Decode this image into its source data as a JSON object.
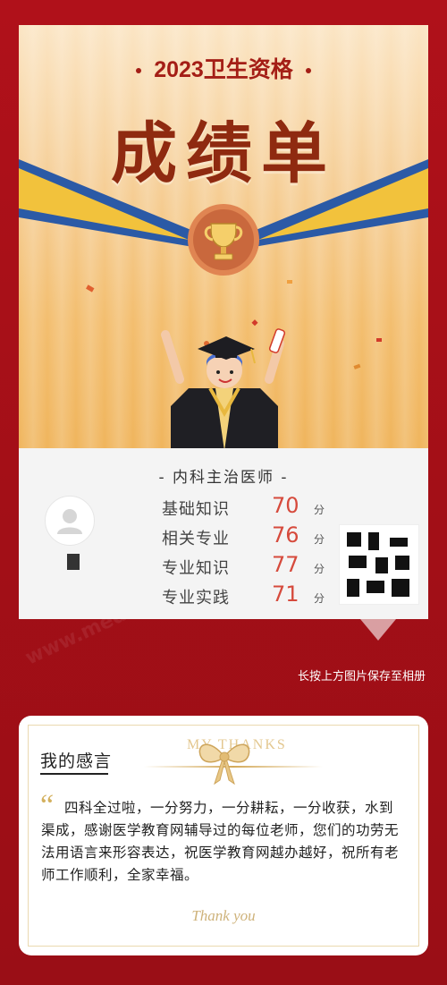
{
  "certificate": {
    "year_title": "2023卫生资格",
    "main_title": "成绩单",
    "subject": "- 内科主治医师 -",
    "scores": [
      {
        "name": "基础知识",
        "score": "70",
        "unit": "分"
      },
      {
        "name": "相关专业",
        "score": "76",
        "unit": "分"
      },
      {
        "name": "专业知识",
        "score": "77",
        "unit": "分"
      },
      {
        "name": "专业实践",
        "score": "71",
        "unit": "分"
      }
    ]
  },
  "save_hint": "长按上方图片保存至相册",
  "thoughts": {
    "title": "我的感言",
    "decor_label": "MY THANKS",
    "quote_glyph": "“",
    "text": "四科全过啦，一分努力，一分耕耘，一分收获，水到渠成，感谢医学教育网辅导过的每位老师，您们的功劳无法用语言来形容表达，祝医学教育网越办越好，祝所有老师工作顺利，全家幸福。",
    "closing": "Thank you"
  },
  "watermark": "www.med66.com",
  "icons": [
    "trophy-icon",
    "graduate-illustration",
    "avatar-placeholder-icon",
    "qr-code-icon",
    "bow-icon"
  ],
  "colors": {
    "background": "#a30f17",
    "title_red": "#a41e16",
    "score_red": "#d64a3c",
    "gold": "#d3b05d"
  }
}
